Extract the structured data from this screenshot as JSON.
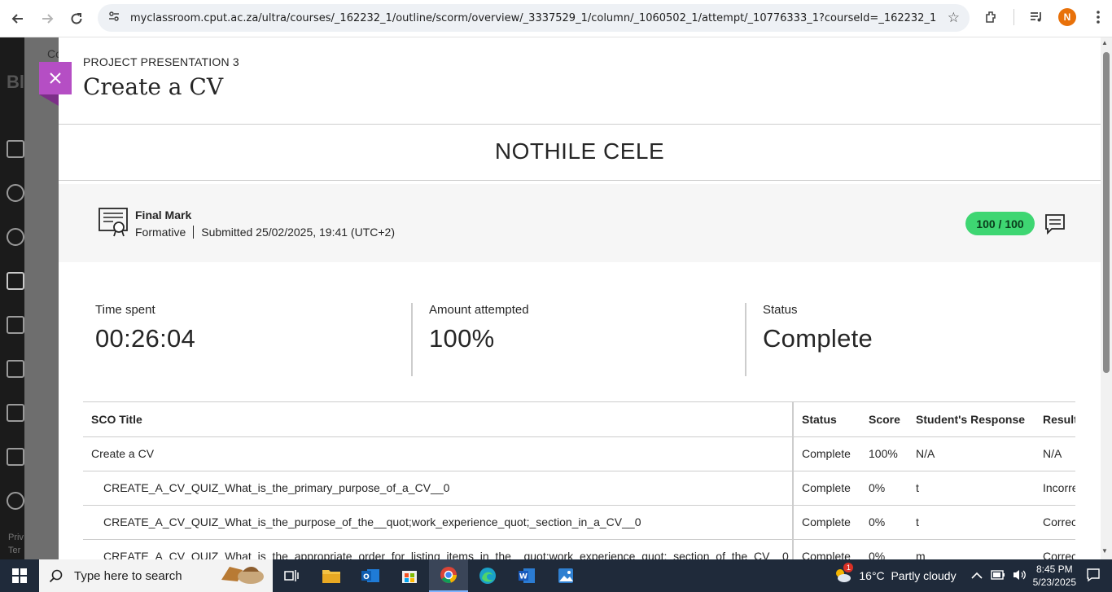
{
  "browser": {
    "url": "myclassroom.cput.ac.za/ultra/courses/_162232_1/outline/scorm/overview/_3337529_1/column/_1060502_1/attempt/_10776333_1?courseId=_162232_1",
    "profile_initial": "N"
  },
  "background_page": {
    "fragments": [
      "Co",
      "Bl",
      "Priv",
      "Ter"
    ]
  },
  "panel": {
    "kicker": "PROJECT PRESENTATION 3",
    "title": "Create a CV",
    "student_name": "NOTHILE CELE",
    "grade": {
      "label": "Final Mark",
      "category": "Formative",
      "submitted": "Submitted 25/02/2025, 19:41 (UTC+2)",
      "score": "100 / 100"
    },
    "stats": [
      {
        "label": "Time spent",
        "value": "00:26:04"
      },
      {
        "label": "Amount attempted",
        "value": "100%"
      },
      {
        "label": "Status",
        "value": "Complete"
      }
    ],
    "table": {
      "headers": [
        "SCO Title",
        "Status",
        "Score",
        "Student's Response",
        "Result"
      ],
      "rows": [
        {
          "title": "Create a CV",
          "status": "Complete",
          "score": "100%",
          "response": "N/A",
          "result": "N/A"
        },
        {
          "title": "CREATE_A_CV_QUIZ_What_is_the_primary_purpose_of_a_CV__0",
          "status": "Complete",
          "score": "0%",
          "response": "t",
          "result": "Incorrect"
        },
        {
          "title": "CREATE_A_CV_QUIZ_What_is_the_purpose_of_the__quot;work_experience_quot;_section_in_a_CV__0",
          "status": "Complete",
          "score": "0%",
          "response": "t",
          "result": "Correct"
        },
        {
          "title": "CREATE_A_CV_QUIZ_What_is_the_appropriate_order_for_listing_items_in_the__quot;work_experience_quot;_section_of_the_CV__0",
          "status": "Complete",
          "score": "0%",
          "response": "m",
          "result": "Correct"
        }
      ]
    }
  },
  "taskbar": {
    "search_placeholder": "Type here to search",
    "weather": "16°C  Partly cloudy",
    "time": "8:45 PM",
    "date": "5/23/2025",
    "notification_count": "1"
  },
  "colors": {
    "accent_close": "#b54ec4",
    "score_pill": "#3ed672",
    "taskbar": "#1f2a3a"
  }
}
